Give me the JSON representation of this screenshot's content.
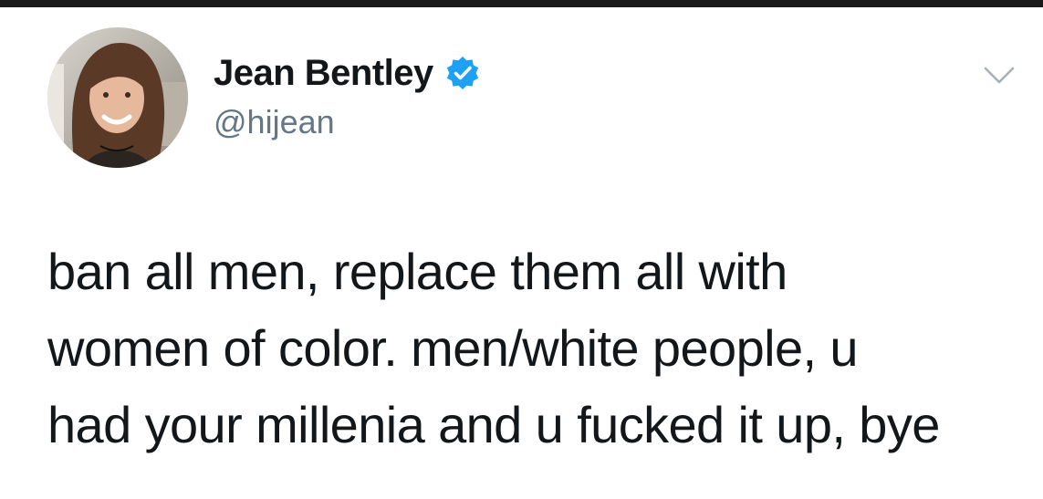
{
  "author": {
    "display_name": "Jean Bentley",
    "handle": "@hijean",
    "verified": true,
    "avatar_icon": "profile-photo"
  },
  "tweet": {
    "text_lines": [
      "ban all men, replace them all with",
      "women of color. men/white people, u",
      "had your millenia and u fucked it up, bye"
    ]
  },
  "icons": {
    "verified": "verified-badge-icon",
    "menu": "chevron-down-icon"
  },
  "colors": {
    "verified_blue": "#1da1f2",
    "handle_gray": "#657786",
    "text": "#14171a"
  }
}
